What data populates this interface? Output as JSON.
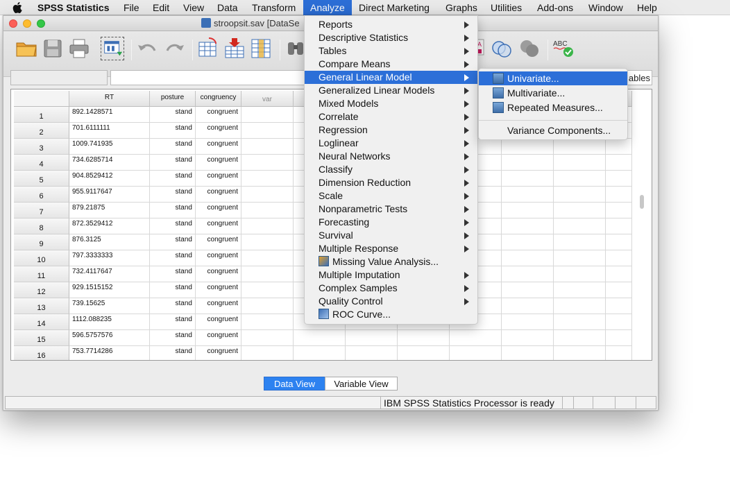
{
  "menubar": {
    "app": "SPSS Statistics",
    "items": [
      "File",
      "Edit",
      "View",
      "Data",
      "Transform",
      "Analyze",
      "Direct Marketing",
      "Graphs",
      "Utilities",
      "Add-ons",
      "Window",
      "Help"
    ],
    "active": "Analyze"
  },
  "window": {
    "title": "stroopsit.sav [DataSe"
  },
  "cell_editor": {
    "name": "",
    "value": "",
    "visible_vars_fragment": "ables"
  },
  "grid": {
    "columns": [
      "RT",
      "posture",
      "congruency",
      "var"
    ],
    "rows": [
      {
        "n": "1",
        "RT": "892.1428571",
        "posture": "stand",
        "congruency": "congruent"
      },
      {
        "n": "2",
        "RT": "701.6111111",
        "posture": "stand",
        "congruency": "congruent"
      },
      {
        "n": "3",
        "RT": "1009.741935",
        "posture": "stand",
        "congruency": "congruent"
      },
      {
        "n": "4",
        "RT": "734.6285714",
        "posture": "stand",
        "congruency": "congruent"
      },
      {
        "n": "5",
        "RT": "904.8529412",
        "posture": "stand",
        "congruency": "congruent"
      },
      {
        "n": "6",
        "RT": "955.9117647",
        "posture": "stand",
        "congruency": "congruent"
      },
      {
        "n": "7",
        "RT": "879.21875",
        "posture": "stand",
        "congruency": "congruent"
      },
      {
        "n": "8",
        "RT": "872.3529412",
        "posture": "stand",
        "congruency": "congruent"
      },
      {
        "n": "9",
        "RT": "876.3125",
        "posture": "stand",
        "congruency": "congruent"
      },
      {
        "n": "10",
        "RT": "797.3333333",
        "posture": "stand",
        "congruency": "congruent"
      },
      {
        "n": "11",
        "RT": "732.4117647",
        "posture": "stand",
        "congruency": "congruent"
      },
      {
        "n": "12",
        "RT": "929.1515152",
        "posture": "stand",
        "congruency": "congruent"
      },
      {
        "n": "13",
        "RT": "739.15625",
        "posture": "stand",
        "congruency": "congruent"
      },
      {
        "n": "14",
        "RT": "1112.088235",
        "posture": "stand",
        "congruency": "congruent"
      },
      {
        "n": "15",
        "RT": "596.5757576",
        "posture": "stand",
        "congruency": "congruent"
      },
      {
        "n": "16",
        "RT": "753.7714286",
        "posture": "stand",
        "congruency": "congruent"
      }
    ]
  },
  "tabs": {
    "data_view": "Data View",
    "variable_view": "Variable View",
    "active": "Data View"
  },
  "status": {
    "text": "IBM SPSS Statistics Processor is ready"
  },
  "analyze_menu": {
    "items": [
      {
        "label": "Reports",
        "submenu": true
      },
      {
        "label": "Descriptive Statistics",
        "submenu": true
      },
      {
        "label": "Tables",
        "submenu": true
      },
      {
        "label": "Compare Means",
        "submenu": true
      },
      {
        "label": "General Linear Model",
        "submenu": true,
        "highlighted": true
      },
      {
        "label": "Generalized Linear Models",
        "submenu": true
      },
      {
        "label": "Mixed Models",
        "submenu": true
      },
      {
        "label": "Correlate",
        "submenu": true
      },
      {
        "label": "Regression",
        "submenu": true
      },
      {
        "label": "Loglinear",
        "submenu": true
      },
      {
        "label": "Neural Networks",
        "submenu": true
      },
      {
        "label": "Classify",
        "submenu": true
      },
      {
        "label": "Dimension Reduction",
        "submenu": true
      },
      {
        "label": "Scale",
        "submenu": true
      },
      {
        "label": "Nonparametric Tests",
        "submenu": true
      },
      {
        "label": "Forecasting",
        "submenu": true
      },
      {
        "label": "Survival",
        "submenu": true
      },
      {
        "label": "Multiple Response",
        "submenu": true
      },
      {
        "label": "Missing Value Analysis...",
        "submenu": false,
        "icon": "missing-value-icon"
      },
      {
        "label": "Multiple Imputation",
        "submenu": true
      },
      {
        "label": "Complex Samples",
        "submenu": true
      },
      {
        "label": "Quality Control",
        "submenu": true
      },
      {
        "label": "ROC Curve...",
        "submenu": false,
        "icon": "roc-curve-icon"
      }
    ]
  },
  "glm_submenu": {
    "items": [
      {
        "label": "Univariate...",
        "icon": "univariate-icon",
        "highlighted": true
      },
      {
        "label": "Multivariate...",
        "icon": "multivariate-icon"
      },
      {
        "label": "Repeated Measures...",
        "icon": "repeated-measures-icon"
      },
      {
        "label": "Variance Components...",
        "icon": ""
      }
    ]
  },
  "colors": {
    "highlight": "#2c6fd8",
    "tab_active": "#2d82f0"
  }
}
